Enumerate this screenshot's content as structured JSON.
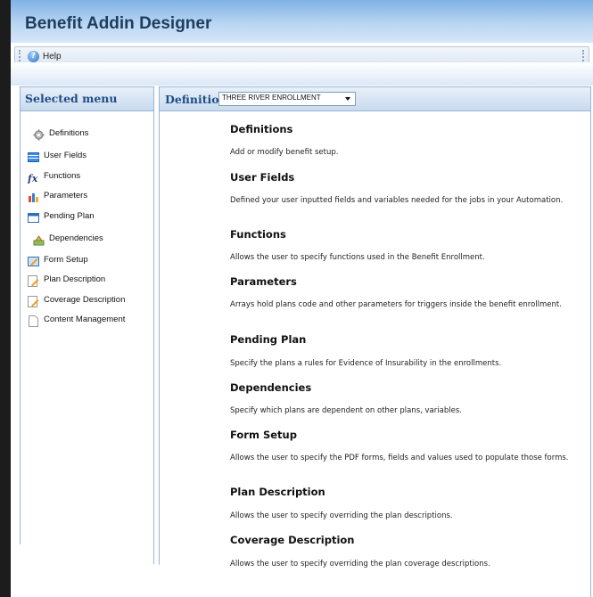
{
  "window": {
    "title": "Benefit Addin Designer"
  },
  "toolbar": {
    "help_label": "Help",
    "help_icon": "help-icon"
  },
  "sidebar": {
    "title": "Selected menu",
    "items": [
      {
        "label": "Definitions",
        "icon": "gear-icon"
      },
      {
        "label": "User Fields",
        "icon": "table-icon"
      },
      {
        "label": "Functions",
        "icon": "function-icon"
      },
      {
        "label": "Parameters",
        "icon": "bar-chart-icon"
      },
      {
        "label": "Pending Plan",
        "icon": "window-icon"
      },
      {
        "label": "Dependencies",
        "icon": "dependencies-icon"
      },
      {
        "label": "Form Setup",
        "icon": "form-icon"
      },
      {
        "label": "Plan Description",
        "icon": "edit-icon"
      },
      {
        "label": "Coverage Description",
        "icon": "edit-icon"
      },
      {
        "label": "Content Management",
        "icon": "page-icon"
      }
    ]
  },
  "main": {
    "definition_label": "Definition:",
    "definition_value": "THREE RIVER ENROLLMENT",
    "sections": [
      {
        "title": "Definitions",
        "desc": "Add or modify benefit setup."
      },
      {
        "title": "User Fields",
        "desc": "Defined your user inputted fields and variables needed for the jobs in your Automation."
      },
      {
        "title": "Functions",
        "desc": "Allows the user to specify functions used in the Benefit Enrollment."
      },
      {
        "title": "Parameters",
        "desc": "Arrays hold plans code and other parameters for triggers inside the benefit enrollment."
      },
      {
        "title": "Pending Plan",
        "desc": "Specify the plans a rules for Evidence of Insurability in the enrollments."
      },
      {
        "title": "Dependencies",
        "desc": "Specify which plans are dependent on other plans, variables."
      },
      {
        "title": "Form Setup",
        "desc": "Allows the user to specify the PDF forms, fields and values used to populate those forms."
      },
      {
        "title": "Plan Description",
        "desc": "Allows the user to specify overriding the plan descriptions."
      },
      {
        "title": "Coverage Description",
        "desc": "Allows the user to specify overriding the plan coverage descriptions."
      }
    ]
  },
  "colors": {
    "accent": "#1e4d86",
    "border": "#9ab4d3",
    "title_bar": "#7fb2e6"
  }
}
